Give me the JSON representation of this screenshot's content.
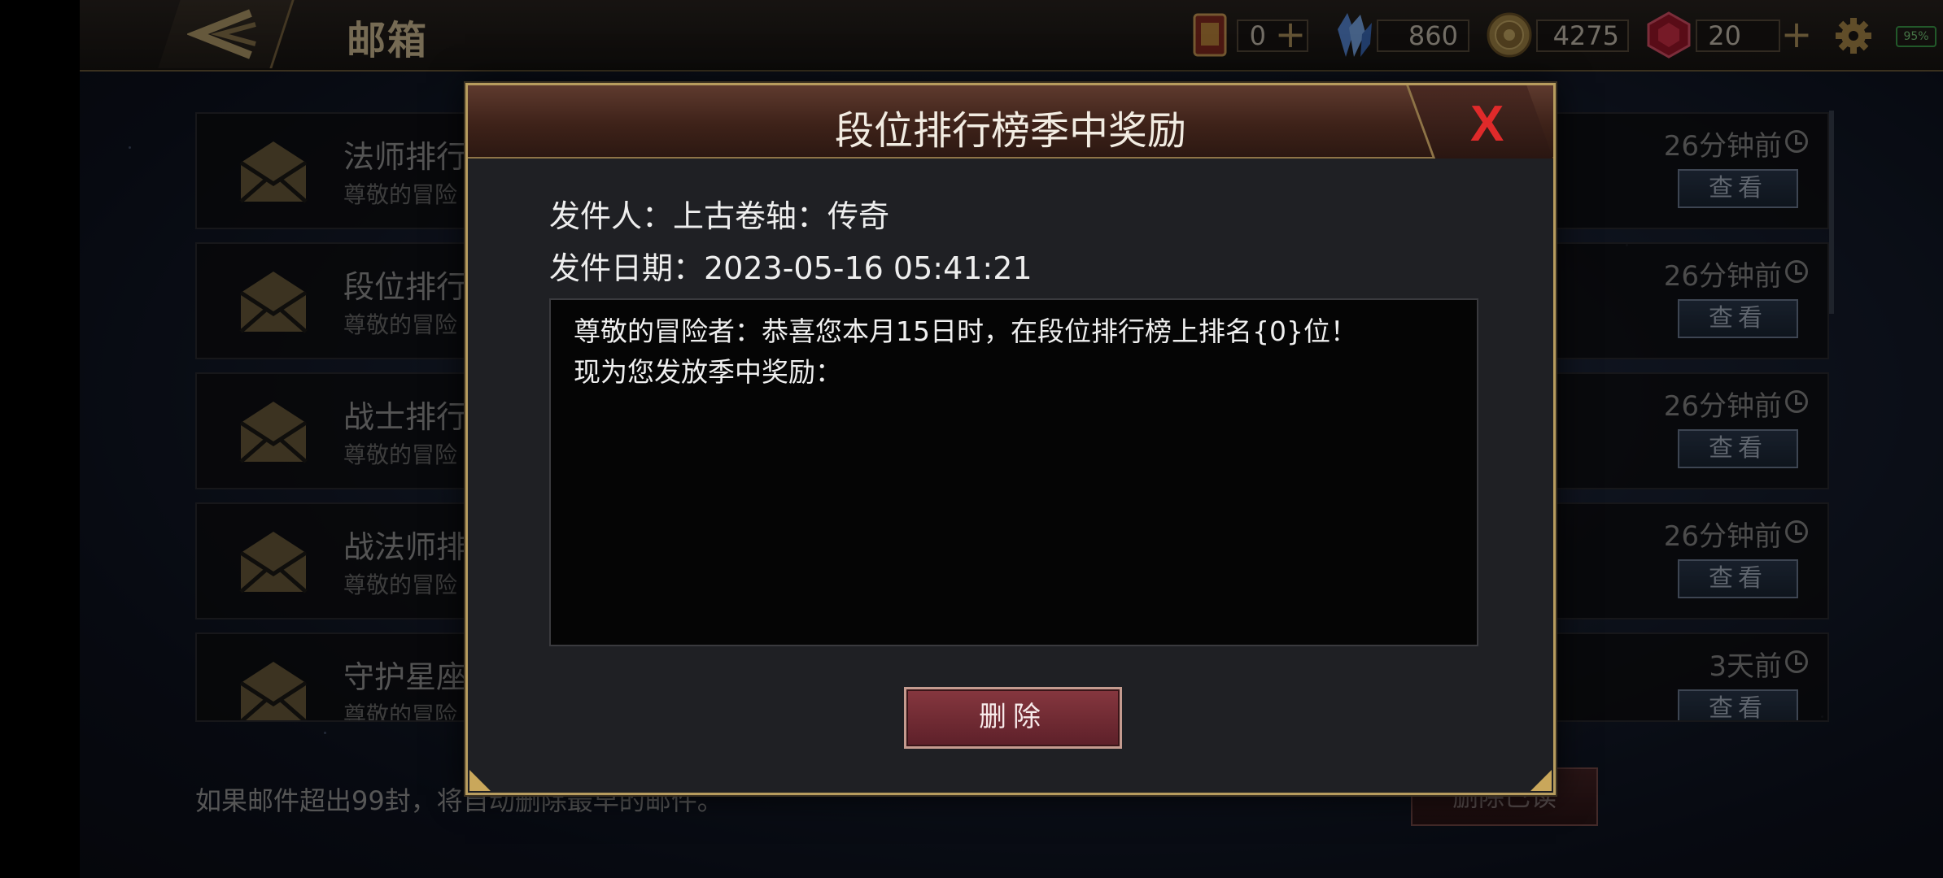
{
  "header": {
    "title": "邮箱",
    "currencies": [
      {
        "icon": "card-book-icon",
        "value": "0",
        "has_plus": true
      },
      {
        "icon": "crystal-icon",
        "value": "860",
        "has_plus": false
      },
      {
        "icon": "gold-coin-icon",
        "value": "4275",
        "has_plus": false
      },
      {
        "icon": "ruby-gem-icon",
        "value": "20",
        "has_plus": true
      }
    ],
    "plus_symbol": "+",
    "battery": "95%"
  },
  "mail_list": {
    "items": [
      {
        "subject": "法师排行",
        "preview": "尊敬的冒险",
        "time": "26分钟前",
        "view_label": "查看"
      },
      {
        "subject": "段位排行",
        "preview": "尊敬的冒险",
        "time": "26分钟前",
        "view_label": "查看"
      },
      {
        "subject": "战士排行",
        "preview": "尊敬的冒险",
        "time": "26分钟前",
        "view_label": "查看"
      },
      {
        "subject": "战法师排",
        "preview": "尊敬的冒险",
        "time": "26分钟前",
        "view_label": "查看"
      },
      {
        "subject": "守护星座",
        "preview": "尊敬的冒险",
        "time": "3天前",
        "view_label": "查看"
      }
    ],
    "footer_note": "如果邮件超出99封，将自动删除最早的邮件。",
    "delete_read_label": "删除已读"
  },
  "modal": {
    "title": "段位排行榜季中奖励",
    "close_label": "X",
    "sender_line": "发件人：上古卷轴：传奇",
    "date_line": "发件日期：2023-05-16 05:41:21",
    "body_lines": [
      "尊敬的冒险者：恭喜您本月15日时，在段位排行榜上排名{0}位！",
      "现为您发放季中奖励："
    ],
    "delete_label": "删除"
  },
  "colors": {
    "accent_gold": "#b79c5e",
    "close_red": "#e02a2a",
    "delete_button": "#86373f"
  }
}
